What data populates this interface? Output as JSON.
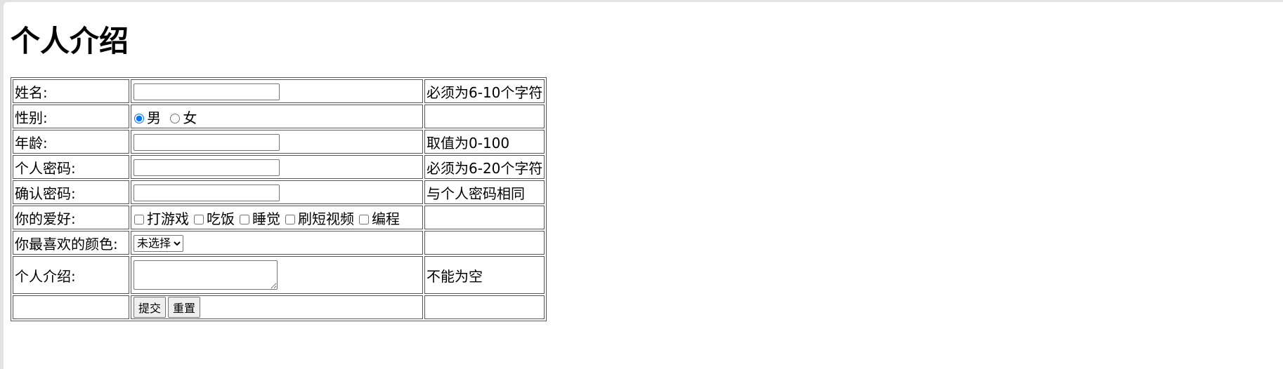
{
  "page": {
    "title": "个人介绍"
  },
  "form": {
    "rows": [
      {
        "label": "姓名:",
        "hint": "必须为6-10个字符",
        "value": ""
      },
      {
        "label": "性别:",
        "hint": ""
      },
      {
        "label": "年龄:",
        "hint": "取值为0-100",
        "value": ""
      },
      {
        "label": "个人密码:",
        "hint": "必须为6-20个字符",
        "value": ""
      },
      {
        "label": "确认密码:",
        "hint": "与个人密码相同",
        "value": ""
      },
      {
        "label": "你的爱好:",
        "hint": ""
      },
      {
        "label": "你最喜欢的颜色:",
        "hint": ""
      },
      {
        "label": "个人介绍:",
        "hint": "不能为空",
        "value": ""
      }
    ],
    "gender_options": [
      {
        "label": "男",
        "checked": true
      },
      {
        "label": "女",
        "checked": false
      }
    ],
    "hobbies": [
      {
        "label": "打游戏",
        "checked": false
      },
      {
        "label": "吃饭",
        "checked": false
      },
      {
        "label": "睡觉",
        "checked": false
      },
      {
        "label": "刷短视频",
        "checked": false
      },
      {
        "label": "编程",
        "checked": false
      }
    ],
    "color_select": {
      "selected": "未选择"
    },
    "buttons": {
      "submit": "提交",
      "reset": "重置"
    }
  }
}
